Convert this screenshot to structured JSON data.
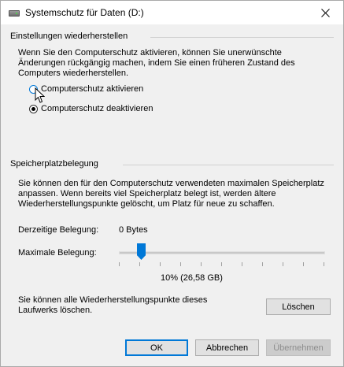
{
  "window": {
    "title": "Systemschutz für Daten (D:)"
  },
  "restore": {
    "header": "Einstellungen wiederherstellen",
    "description": "Wenn Sie den Computerschutz aktivieren, können Sie unerwünschte Änderungen rückgängig machen, indem Sie einen früheren Zustand des Computers wiederherstellen.",
    "options": [
      {
        "label": "Computerschutz aktivieren",
        "checked": false
      },
      {
        "label": "Computerschutz deaktivieren",
        "checked": true
      }
    ]
  },
  "storage": {
    "header": "Speicherplatzbelegung",
    "description": "Sie können den für den Computerschutz verwendeten maximalen Speicherplatz anpassen. Wenn bereits viel Speicherplatz belegt ist, werden ältere Wiederherstellungspunkte gelöscht, um Platz für neue zu schaffen.",
    "current_label": "Derzeitige Belegung:",
    "current_value": "0 Bytes",
    "max_label": "Maximale Belegung:",
    "slider_percent": 10,
    "slider_readout": "10% (26,58 GB)",
    "delete_text": "Sie können alle Wiederherstellungspunkte dieses Laufwerks löschen.",
    "delete_button": "Löschen"
  },
  "footer": {
    "ok": "OK",
    "cancel": "Abbrechen",
    "apply": "Übernehmen"
  }
}
